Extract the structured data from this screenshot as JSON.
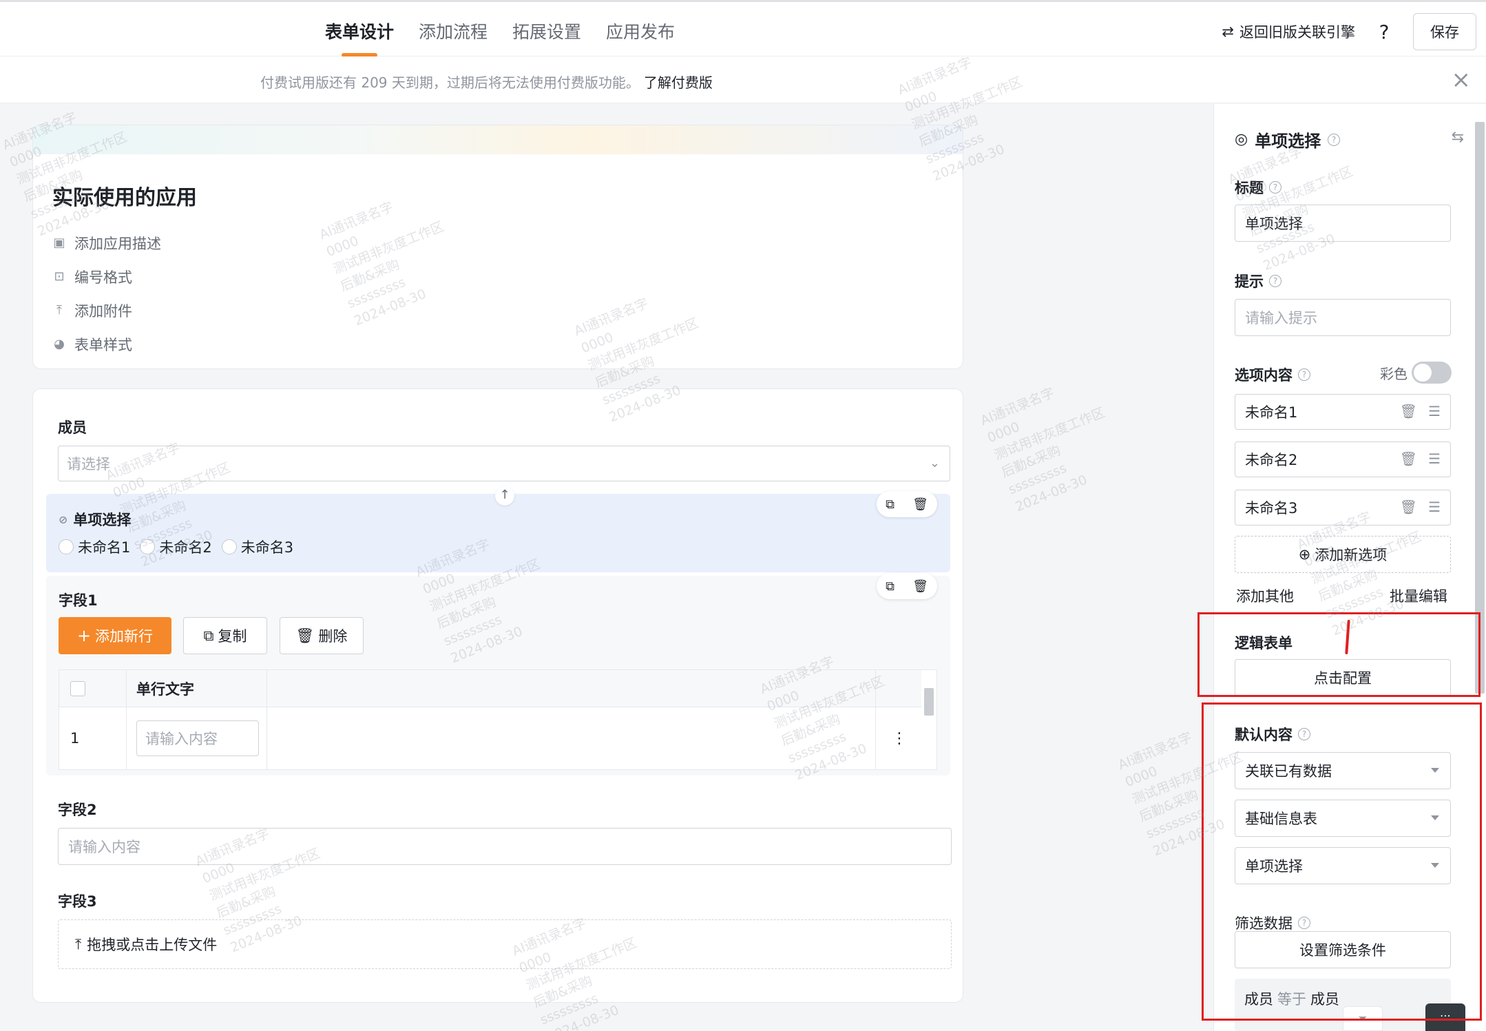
{
  "nav": {
    "tabs": [
      {
        "label": "表单设计",
        "active": true
      },
      {
        "label": "添加流程",
        "active": false
      },
      {
        "label": "拓展设置",
        "active": false
      },
      {
        "label": "应用发布",
        "active": false
      }
    ],
    "legacy_link": "返回旧版关联引擎",
    "help": "?",
    "save": "保存"
  },
  "banner": {
    "text": "付费试用版还有 209 天到期，过期后将无法使用付费版功能。",
    "link": "了解付费版",
    "close": "×"
  },
  "app": {
    "title": "实际使用的应用",
    "meta": [
      "添加应用描述",
      "编号格式",
      "添加附件",
      "表单样式"
    ]
  },
  "form": {
    "member": {
      "label": "成员",
      "placeholder": "请选择"
    },
    "radio": {
      "label": "单项选择",
      "options": [
        "未命名1",
        "未命名2",
        "未命名3"
      ]
    },
    "field1": {
      "label": "字段1",
      "add_row": "添加新行",
      "copy": "复制",
      "delete": "删除",
      "column": "单行文字",
      "row_index": "1",
      "cell_placeholder": "请输入内容"
    },
    "field2": {
      "label": "字段2",
      "placeholder": "请输入内容"
    },
    "field3": {
      "label": "字段3",
      "upload": "拖拽或点击上传文件"
    }
  },
  "panel": {
    "title": "单项选择",
    "title_label": "标题",
    "title_value": "单项选择",
    "hint_label": "提示",
    "hint_placeholder": "请输入提示",
    "options_label": "选项内容",
    "color_label": "彩色",
    "options": [
      "未命名1",
      "未命名2",
      "未命名3"
    ],
    "add_option": "添加新选项",
    "add_other": "添加其他",
    "bulk_edit": "批量编辑",
    "logic_label": "逻辑表单",
    "logic_button": "点击配置",
    "default_label": "默认内容",
    "default_mode": "关联已有数据",
    "default_table": "基础信息表",
    "default_field": "单项选择",
    "filter_label": "筛选数据",
    "filter_button": "设置筛选条件",
    "filter_field": "成员",
    "filter_op": "等于",
    "filter_value": "成员"
  },
  "watermark": {
    "lines": [
      "AI通讯录名字",
      "0000",
      "测试用非灰度工作区",
      "后勤&采购",
      "sssssssss",
      "2024-08-30"
    ]
  }
}
